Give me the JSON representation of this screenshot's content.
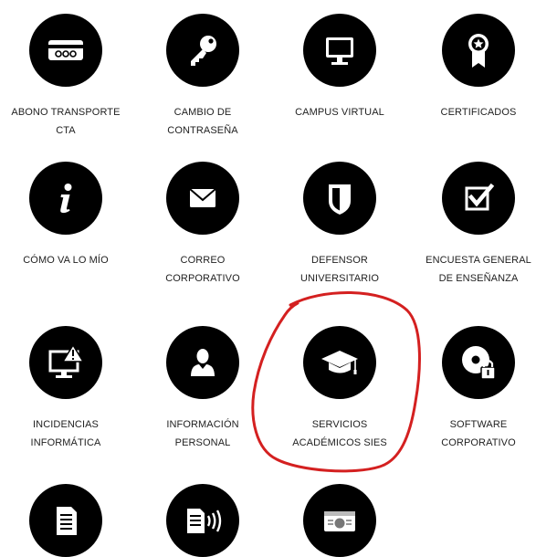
{
  "services": [
    {
      "id": "abono",
      "icon": "ticket-card-icon",
      "label_lines": [
        "ABONO TRANSPORTE",
        "CTA"
      ]
    },
    {
      "id": "cambio",
      "icon": "key-icon",
      "label_lines": [
        "CAMBIO DE",
        "CONTRASEÑA"
      ]
    },
    {
      "id": "campus",
      "icon": "monitor-icon",
      "label_lines": [
        "CAMPUS VIRTUAL"
      ]
    },
    {
      "id": "certificados",
      "icon": "award-ribbon-icon",
      "label_lines": [
        "CERTIFICADOS"
      ]
    },
    {
      "id": "como-va",
      "icon": "info-icon",
      "label_lines": [
        "CÓMO VA LO MÍO"
      ]
    },
    {
      "id": "correo",
      "icon": "envelope-icon",
      "label_lines": [
        "CORREO",
        "CORPORATIVO"
      ]
    },
    {
      "id": "defensor",
      "icon": "shield-icon",
      "label_lines": [
        "DEFENSOR",
        "UNIVERSITARIO"
      ]
    },
    {
      "id": "encuesta",
      "icon": "checkbox-icon",
      "label_lines": [
        "ENCUESTA GENERAL",
        "DE ENSEÑANZA"
      ]
    },
    {
      "id": "incidencias",
      "icon": "monitor-warning-icon",
      "label_lines": [
        "INCIDENCIAS",
        "INFORMÁTICA"
      ]
    },
    {
      "id": "informacion",
      "icon": "user-icon",
      "label_lines": [
        "INFORMACIÓN",
        "PERSONAL"
      ]
    },
    {
      "id": "servicios",
      "icon": "graduation-cap-icon",
      "label_lines": [
        "SERVICIOS",
        "ACADÉMICOS SIES"
      ]
    },
    {
      "id": "software",
      "icon": "disc-lock-icon",
      "label_lines": [
        "SOFTWARE",
        "CORPORATIVO"
      ]
    },
    {
      "id": "doc",
      "icon": "document-icon",
      "label_lines": []
    },
    {
      "id": "doc-wireless",
      "icon": "document-wireless-icon",
      "label_lines": []
    },
    {
      "id": "id-card",
      "icon": "id-card-icon",
      "label_lines": []
    }
  ],
  "colors": {
    "icon_bg": "#000000",
    "icon_fg": "#ffffff",
    "label": "#222222",
    "annotation": "#d42020"
  }
}
